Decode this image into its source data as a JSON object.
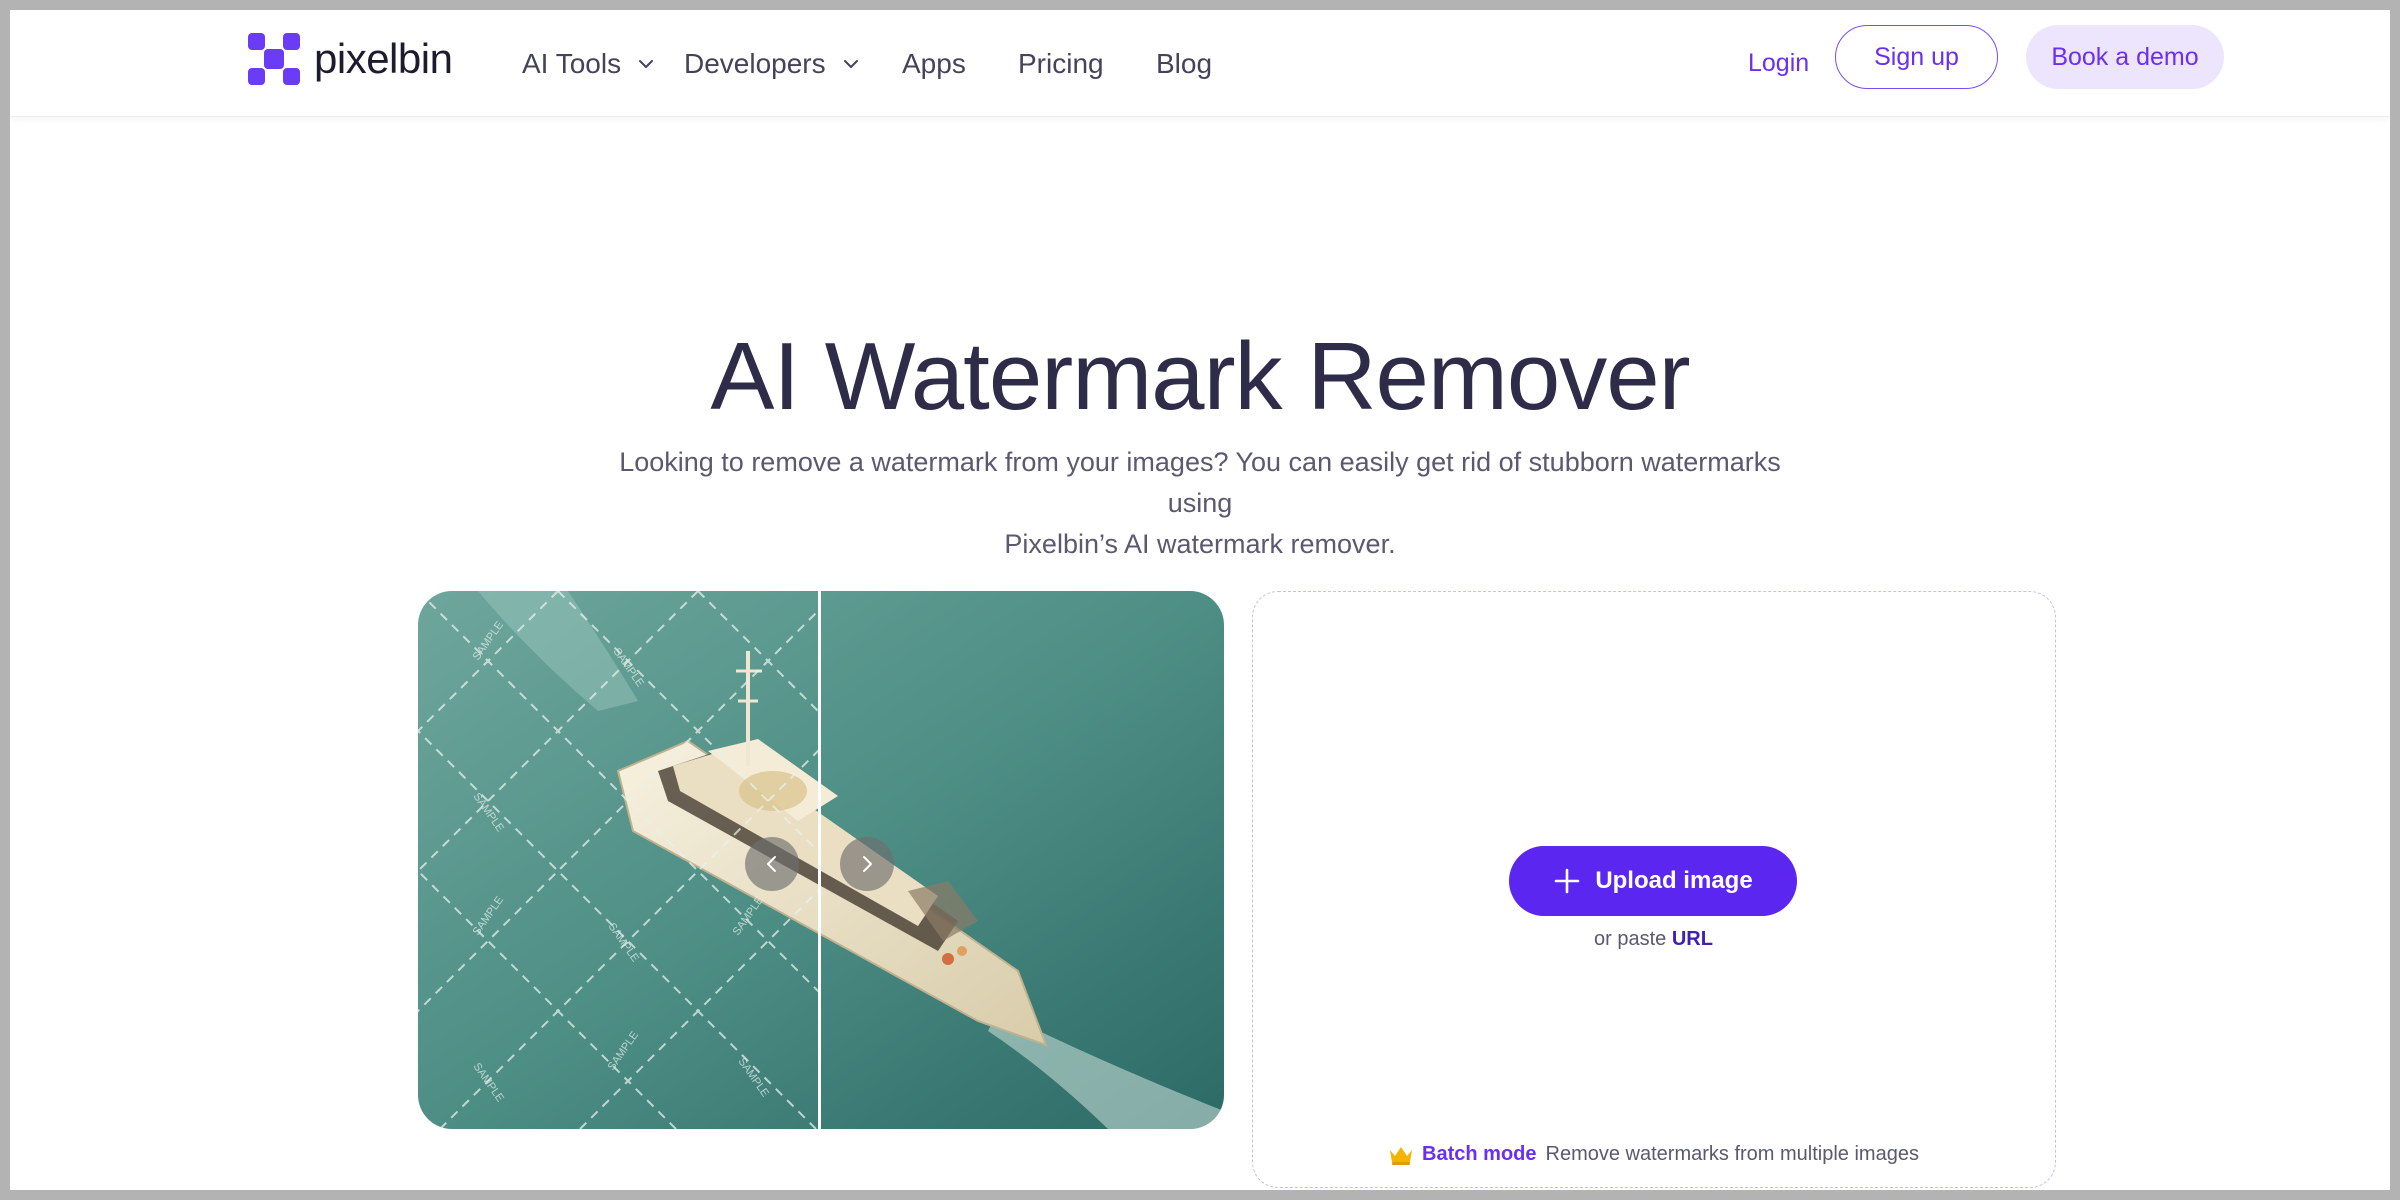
{
  "brand": {
    "name": "pixelbin",
    "accent": "#5b26f0",
    "logo_color": "#6a3cf5"
  },
  "nav": {
    "items": [
      {
        "label": "AI Tools",
        "has_dropdown": true
      },
      {
        "label": "Developers",
        "has_dropdown": true
      },
      {
        "label": "Apps",
        "has_dropdown": false
      },
      {
        "label": "Pricing",
        "has_dropdown": false
      },
      {
        "label": "Blog",
        "has_dropdown": false
      }
    ],
    "login_label": "Login",
    "signup_label": "Sign up",
    "demo_label": "Book a demo"
  },
  "hero": {
    "title": "AI Watermark Remover",
    "subtitle_line1": "Looking to remove a watermark from your images? You can easily get rid of stubborn watermarks using",
    "subtitle_line2": "Pixelbin’s AI watermark remover."
  },
  "compare": {
    "watermark_text": "SAMPLE",
    "prev_icon": "chevron-left-icon",
    "next_icon": "chevron-right-icon"
  },
  "upload": {
    "button_label": "Upload image",
    "paste_prefix": "or paste",
    "paste_link": "URL",
    "batch_label": "Batch mode",
    "batch_text": "Remove watermarks from multiple images",
    "batch_icon": "crown-icon"
  }
}
